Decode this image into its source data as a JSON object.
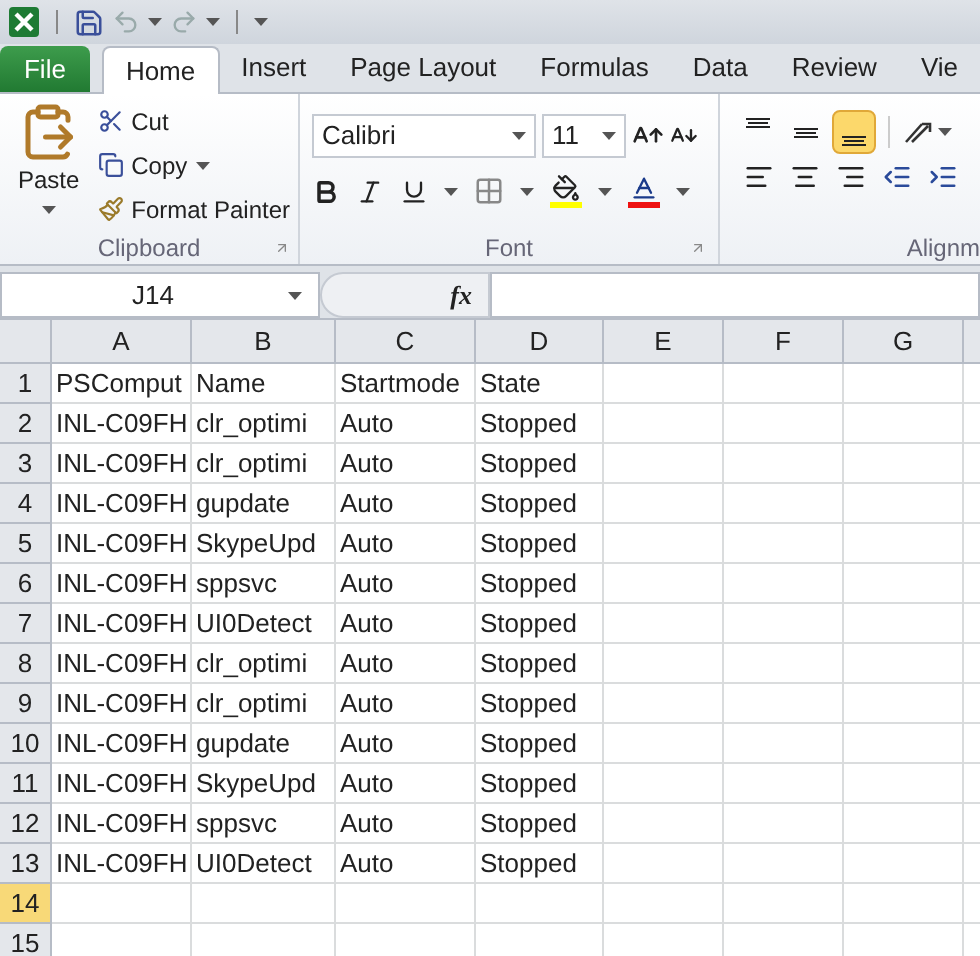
{
  "tabs": [
    {
      "label": "File",
      "kind": "file",
      "selected": false
    },
    {
      "label": "Home",
      "kind": "normal",
      "selected": true
    },
    {
      "label": "Insert",
      "kind": "normal",
      "selected": false
    },
    {
      "label": "Page Layout",
      "kind": "normal",
      "selected": false
    },
    {
      "label": "Formulas",
      "kind": "normal",
      "selected": false
    },
    {
      "label": "Data",
      "kind": "normal",
      "selected": false
    },
    {
      "label": "Review",
      "kind": "normal",
      "selected": false
    },
    {
      "label": "Vie",
      "kind": "normal",
      "selected": false
    }
  ],
  "clipboard": {
    "paste": "Paste",
    "cut": "Cut",
    "copy": "Copy",
    "format_painter": "Format Painter",
    "label": "Clipboard"
  },
  "font": {
    "name": "Calibri",
    "size": "11",
    "label": "Font"
  },
  "alignment": {
    "label": "Alignm",
    "vertical": [
      {
        "kind": "top",
        "selected": false
      },
      {
        "kind": "middle",
        "selected": false
      },
      {
        "kind": "bottom",
        "selected": true
      }
    ]
  },
  "formula_bar": {
    "name_box": "J14",
    "function_label": "fx"
  },
  "columns": [
    {
      "label": "A",
      "selected": false
    },
    {
      "label": "B",
      "selected": false
    },
    {
      "label": "C",
      "selected": false
    },
    {
      "label": "D",
      "selected": false
    },
    {
      "label": "E",
      "selected": false
    },
    {
      "label": "F",
      "selected": false
    },
    {
      "label": "G",
      "selected": false
    }
  ],
  "rows": [
    {
      "number": "1",
      "selected": false,
      "cells": [
        "PSComput",
        "Name",
        "Startmode",
        "State"
      ]
    },
    {
      "number": "2",
      "selected": false,
      "cells": [
        "INL-C09FH",
        "clr_optimi",
        "Auto",
        "Stopped"
      ]
    },
    {
      "number": "3",
      "selected": false,
      "cells": [
        "INL-C09FH",
        "clr_optimi",
        "Auto",
        "Stopped"
      ]
    },
    {
      "number": "4",
      "selected": false,
      "cells": [
        "INL-C09FH",
        "gupdate",
        "Auto",
        "Stopped"
      ]
    },
    {
      "number": "5",
      "selected": false,
      "cells": [
        "INL-C09FH",
        "SkypeUpd",
        "Auto",
        "Stopped"
      ]
    },
    {
      "number": "6",
      "selected": false,
      "cells": [
        "INL-C09FH",
        "sppsvc",
        "Auto",
        "Stopped"
      ]
    },
    {
      "number": "7",
      "selected": false,
      "cells": [
        "INL-C09FH",
        "UI0Detect",
        "Auto",
        "Stopped"
      ]
    },
    {
      "number": "8",
      "selected": false,
      "cells": [
        "INL-C09FH",
        "clr_optimi",
        "Auto",
        "Stopped"
      ]
    },
    {
      "number": "9",
      "selected": false,
      "cells": [
        "INL-C09FH",
        "clr_optimi",
        "Auto",
        "Stopped"
      ]
    },
    {
      "number": "10",
      "selected": false,
      "cells": [
        "INL-C09FH",
        "gupdate",
        "Auto",
        "Stopped"
      ]
    },
    {
      "number": "11",
      "selected": false,
      "cells": [
        "INL-C09FH",
        "SkypeUpd",
        "Auto",
        "Stopped"
      ]
    },
    {
      "number": "12",
      "selected": false,
      "cells": [
        "INL-C09FH",
        "sppsvc",
        "Auto",
        "Stopped"
      ]
    },
    {
      "number": "13",
      "selected": false,
      "cells": [
        "INL-C09FH",
        "UI0Detect",
        "Auto",
        "Stopped"
      ]
    },
    {
      "number": "14",
      "selected": true,
      "cells": []
    },
    {
      "number": "15",
      "selected": false,
      "cells": []
    }
  ]
}
